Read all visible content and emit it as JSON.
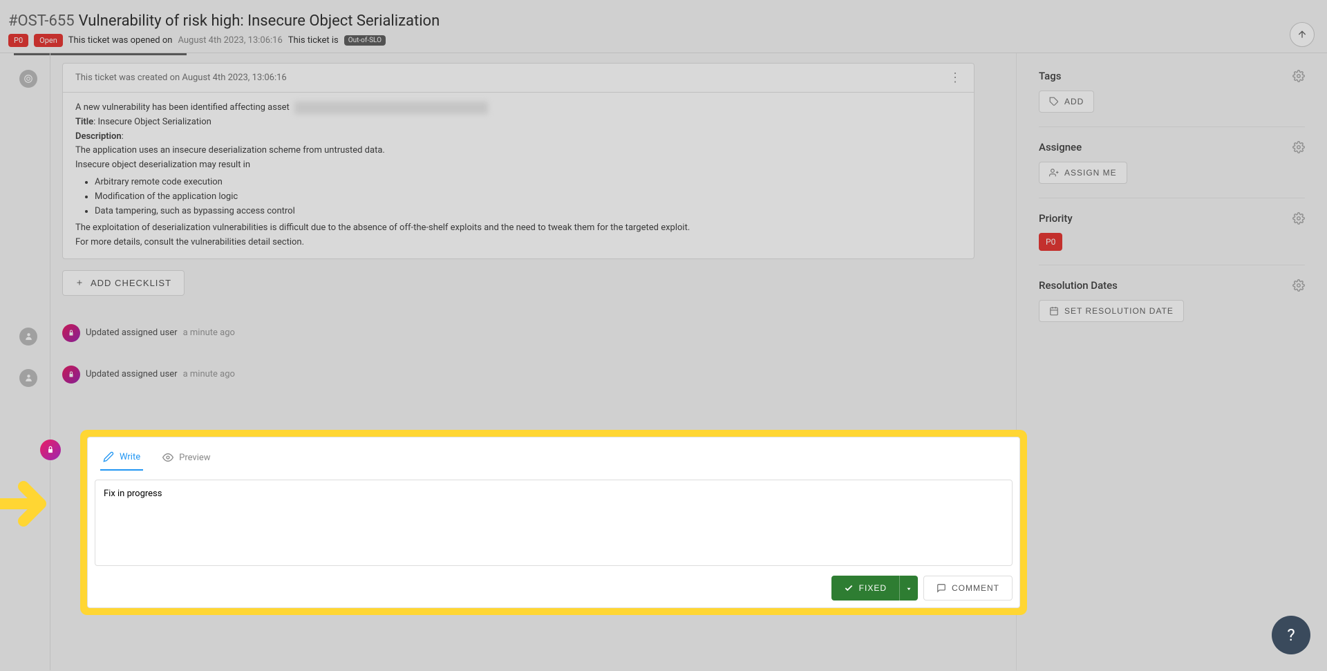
{
  "header": {
    "ticket_id": "#OST-655",
    "title": "Vulnerability of risk high: Insecure Object Serialization",
    "priority_badge": "P0",
    "status_badge": "Open",
    "opened_text": "This ticket was opened on",
    "opened_date": "August 4th 2023, 13:06:16",
    "status_text": "This ticket is",
    "slo_badge": "Out-of-SLO"
  },
  "ticket_card": {
    "created_text": "This ticket was created on August 4th 2023, 13:06:16",
    "intro": "A new vulnerability has been identified affecting asset",
    "title_label": "Title",
    "title_value": ": Insecure Object Serialization",
    "desc_label": "Description",
    "desc_line1": "The application uses an insecure deserialization scheme from untrusted data.",
    "desc_line2": "Insecure object deserialization may result in",
    "bullets": [
      "Arbitrary remote code execution",
      "Modification of the application logic",
      "Data tampering, such as bypassing access control"
    ],
    "desc_line3": "The exploitation of deserialization vulnerabilities is difficult due to the absence of off-the-shelf exploits and the need to tweak them for the targeted exploit.",
    "desc_line4": "For more details, consult the vulnerabilities detail section."
  },
  "add_checklist_label": "ADD CHECKLIST",
  "activities": [
    {
      "text": "Updated assigned user",
      "time": "a minute ago"
    },
    {
      "text": "Updated assigned user",
      "time": "a minute ago"
    }
  ],
  "comment_box": {
    "write_tab": "Write",
    "preview_tab": "Preview",
    "content": "Fix in progress",
    "fixed_btn": "FIXED",
    "comment_btn": "COMMENT"
  },
  "sidebar": {
    "tags_title": "Tags",
    "add_btn": "ADD",
    "assignee_title": "Assignee",
    "assign_me_btn": "ASSIGN ME",
    "priority_title": "Priority",
    "priority_value": "P0",
    "resolution_title": "Resolution Dates",
    "set_resolution_btn": "SET RESOLUTION DATE"
  },
  "help_label": "?"
}
